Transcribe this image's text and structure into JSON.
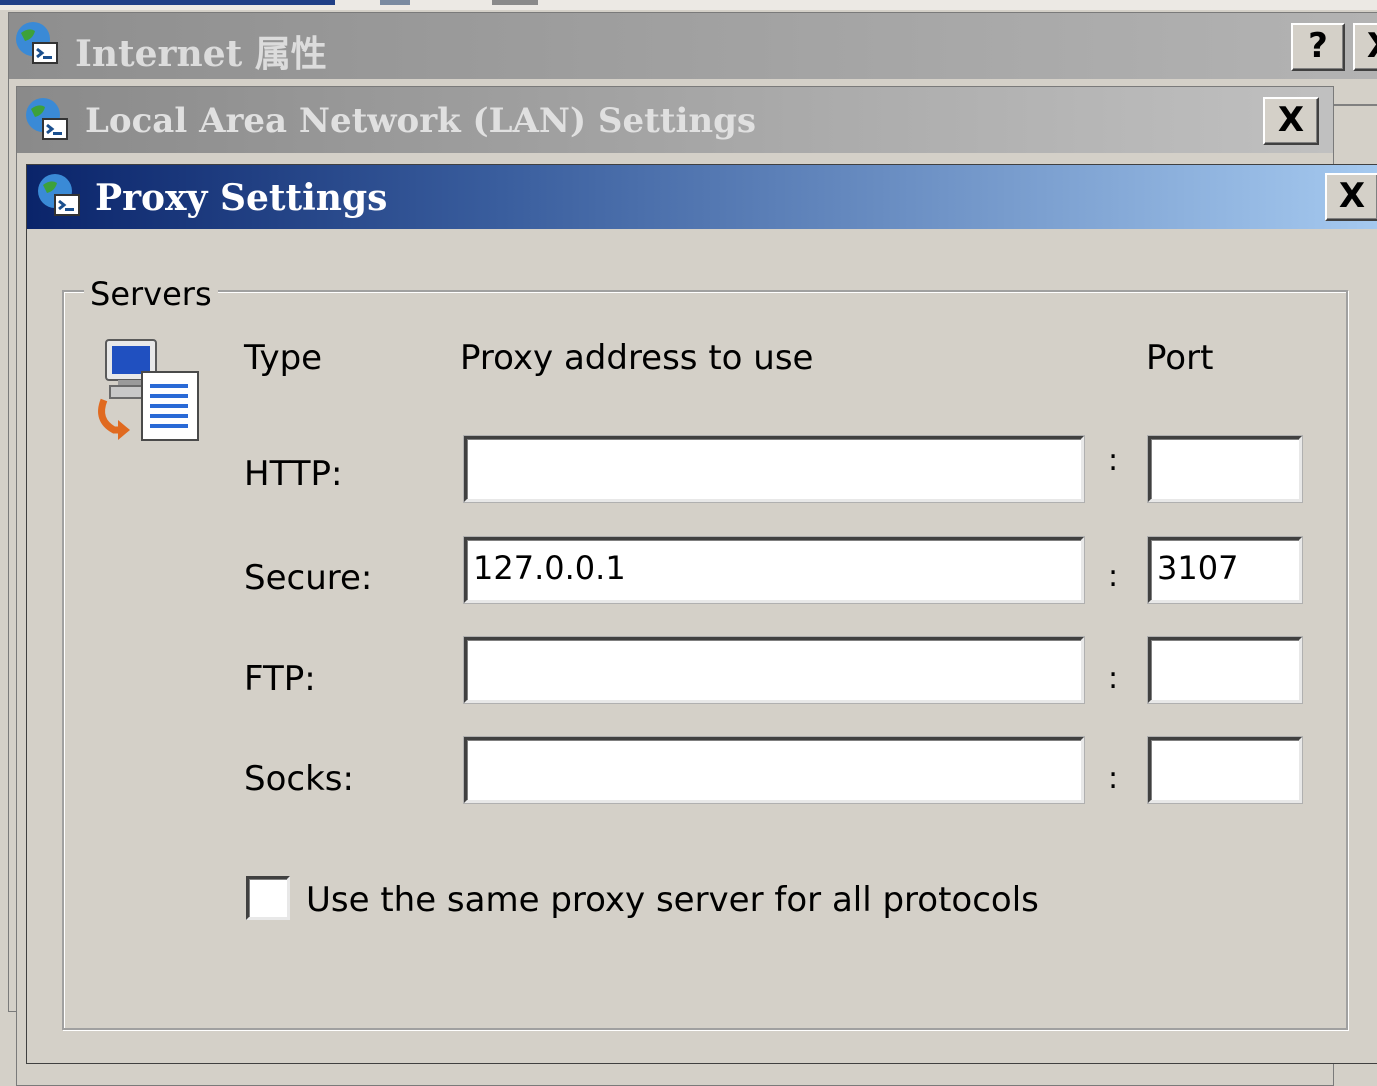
{
  "windows": {
    "internet_properties": {
      "title": "Internet 属性",
      "help_label": "?",
      "close_label": "X"
    },
    "lan_settings": {
      "title": "Local Area Network (LAN) Settings",
      "close_label": "X"
    },
    "proxy_settings": {
      "title": "Proxy Settings",
      "close_label": "X"
    }
  },
  "servers": {
    "group_label": "Servers",
    "icon": "network-server-icon",
    "headers": {
      "type": "Type",
      "address": "Proxy address to use",
      "port": "Port"
    },
    "rows": [
      {
        "type": "HTTP:",
        "address": "",
        "port": ""
      },
      {
        "type": "Secure:",
        "address": "127.0.0.1",
        "port": "3107"
      },
      {
        "type": "FTP:",
        "address": "",
        "port": ""
      },
      {
        "type": "Socks:",
        "address": "",
        "port": ""
      }
    ],
    "colon": ":",
    "same_proxy": {
      "label": "Use the same proxy server for all protocols",
      "checked": false
    }
  },
  "colors": {
    "dialog_bg": "#d4d0c8",
    "active_title_start": "#0a246a",
    "active_title_end": "#a6caf0",
    "inactive_title": "#a8a8a8"
  }
}
